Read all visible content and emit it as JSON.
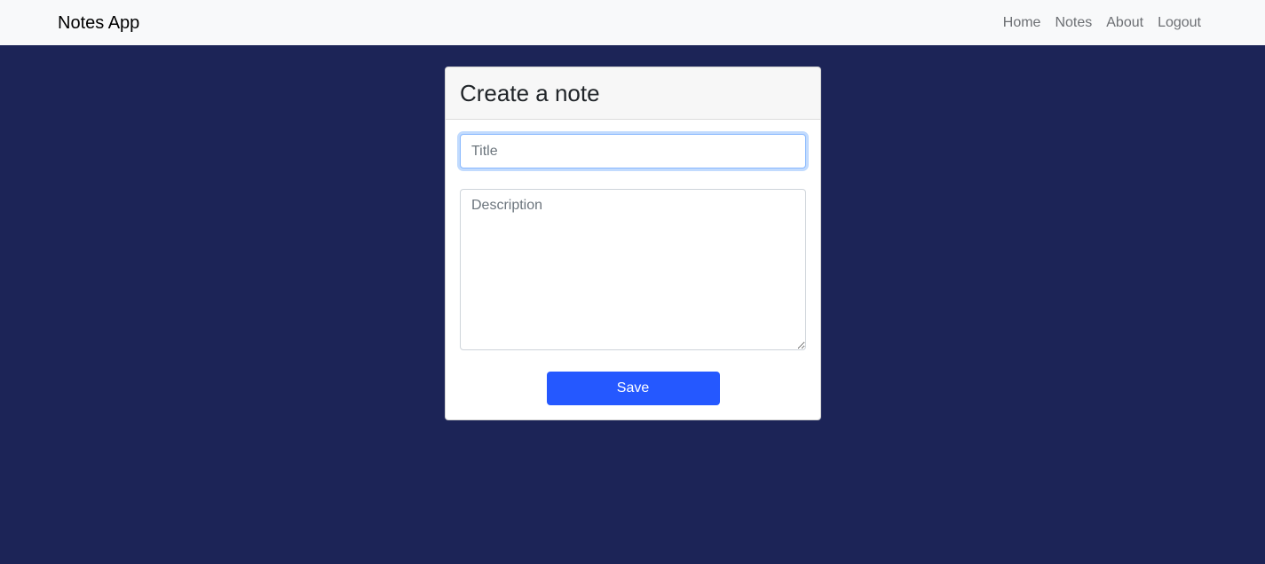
{
  "navbar": {
    "brand": "Notes App",
    "links": [
      {
        "label": "Home"
      },
      {
        "label": "Notes"
      },
      {
        "label": "About"
      },
      {
        "label": "Logout"
      }
    ]
  },
  "form": {
    "heading": "Create a note",
    "title_placeholder": "Title",
    "title_value": "",
    "description_placeholder": "Description",
    "description_value": "",
    "save_label": "Save"
  },
  "colors": {
    "background": "#1c2457",
    "navbar": "#f8f9fa",
    "primary_button": "#2558ff"
  }
}
